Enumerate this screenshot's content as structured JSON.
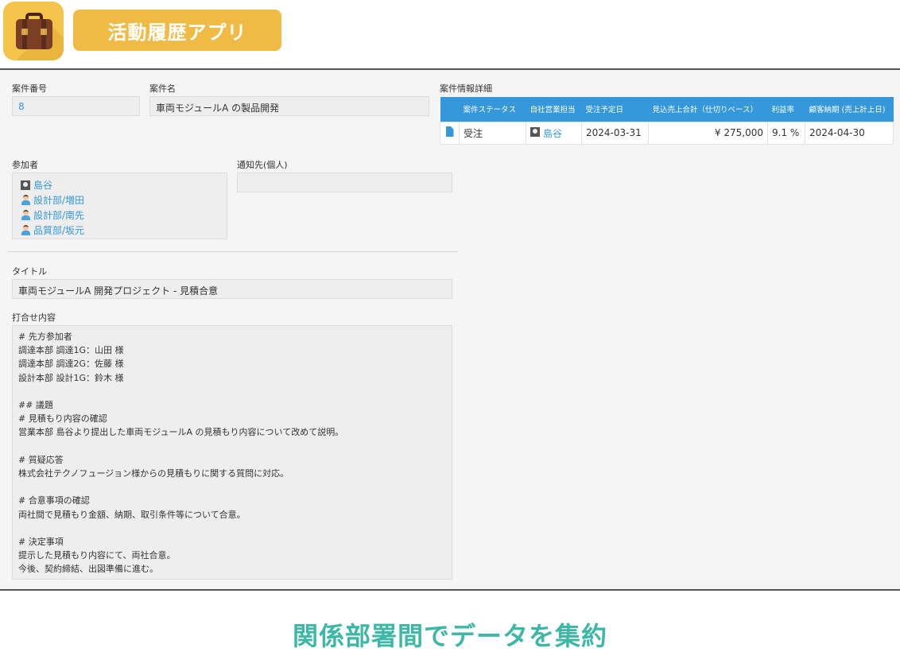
{
  "header": {
    "app_title": "活動履歴アプリ",
    "icon": "briefcase-icon"
  },
  "fields": {
    "case_number_label": "案件番号",
    "case_number_value": "8",
    "case_name_label": "案件名",
    "case_name_value": "車両モジュールA の製品開発",
    "participants_label": "参加者",
    "participants": [
      {
        "name": "島谷",
        "icon": "user-square-icon"
      },
      {
        "name": "設計部/増田",
        "icon": "person-icon"
      },
      {
        "name": "設計部/南先",
        "icon": "person-icon"
      },
      {
        "name": "品質部/坂元",
        "icon": "person-icon"
      }
    ],
    "notify_label": "通知先(個人)",
    "notify_value": "",
    "title_label": "タイトル",
    "title_value": "車両モジュールA 開発プロジェクト - 見積合意",
    "memo_label": "打合せ内容",
    "memo_value": "# 先方参加者\n調達本部 調達1G：山田 様\n調達本部 調達2G：佐藤 様\n設計本部 設計1G：鈴木 様\n\n## 議題\n# 見積もり内容の確認\n営業本部 島谷より提出した車両モジュールA の見積もり内容について改めて説明。\n\n# 質疑応答\n株式会社テクノフュージョン様からの見積もりに関する質問に対応。\n\n# 合意事項の確認\n両社間で見積もり金額、納期、取引条件等について合意。\n\n# 決定事項\n提示した見積もり内容にて、両社合意。\n今後、契約締結、出図準備に進む。"
  },
  "detail": {
    "label": "案件情報詳細",
    "columns": [
      "",
      "案件ステータス",
      "自社営業担当",
      "受注予定日",
      "見込売上合計（仕切りベース）",
      "利益率",
      "顧客納期 (売上計上日)"
    ],
    "rows": [
      {
        "status": "受注",
        "rep": "島谷",
        "order_date": "2024-03-31",
        "sales": "¥ 275,000",
        "margin": "9.1 %",
        "delivery": "2024-04-30"
      }
    ]
  },
  "caption": "関係部署間でデータを集約",
  "colors": {
    "accent": "#3498db",
    "brand": "#f0bb45",
    "caption": "#3db7a6"
  }
}
